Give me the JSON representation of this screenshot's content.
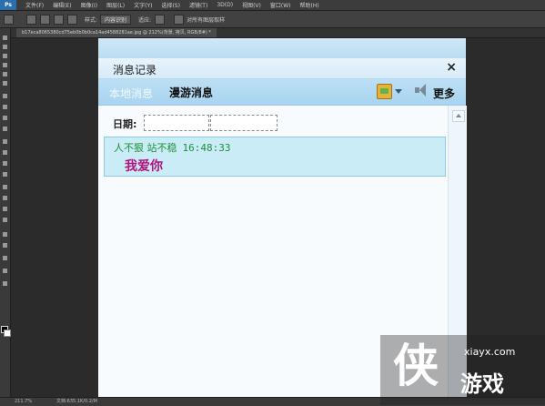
{
  "photoshop": {
    "menu": [
      "文件(F)",
      "编辑(E)",
      "图像(I)",
      "图层(L)",
      "文字(Y)",
      "选择(S)",
      "滤镜(T)",
      "3D(D)",
      "视图(V)",
      "窗口(W)",
      "帮助(H)"
    ],
    "options": {
      "style_label": "样式:",
      "style_value": "内容识别",
      "opacity_label": "适应:",
      "sample_all_layers": "对所有图层取样"
    },
    "doc_tab": "b17eca8065380cd75eb0b0b0ca14ad4588281ae.jpg @ 212%(背景, 拷贝, RGB/8#) *",
    "status": {
      "zoom": "211.7%",
      "doc": "文档:635.1K/0.2/M"
    }
  },
  "chat_history": {
    "title": "消息记录",
    "close_glyph": "×",
    "tabs": {
      "local": "本地消息",
      "roaming": "漫游消息"
    },
    "more_label": "更多",
    "date_label": "日期:",
    "messages": [
      {
        "sender": "人不狠 站不稳",
        "time": "16:48:33",
        "text": "我爱你"
      }
    ]
  },
  "watermark": {
    "glyph": "侠",
    "url": "xiayx.com",
    "brand": "游戏"
  },
  "colors": {
    "tab_strip": "#a9d4ef",
    "message_bg": "#c9ecf7",
    "sender_green": "#1f8f3a",
    "message_magenta": "#b0127d"
  }
}
